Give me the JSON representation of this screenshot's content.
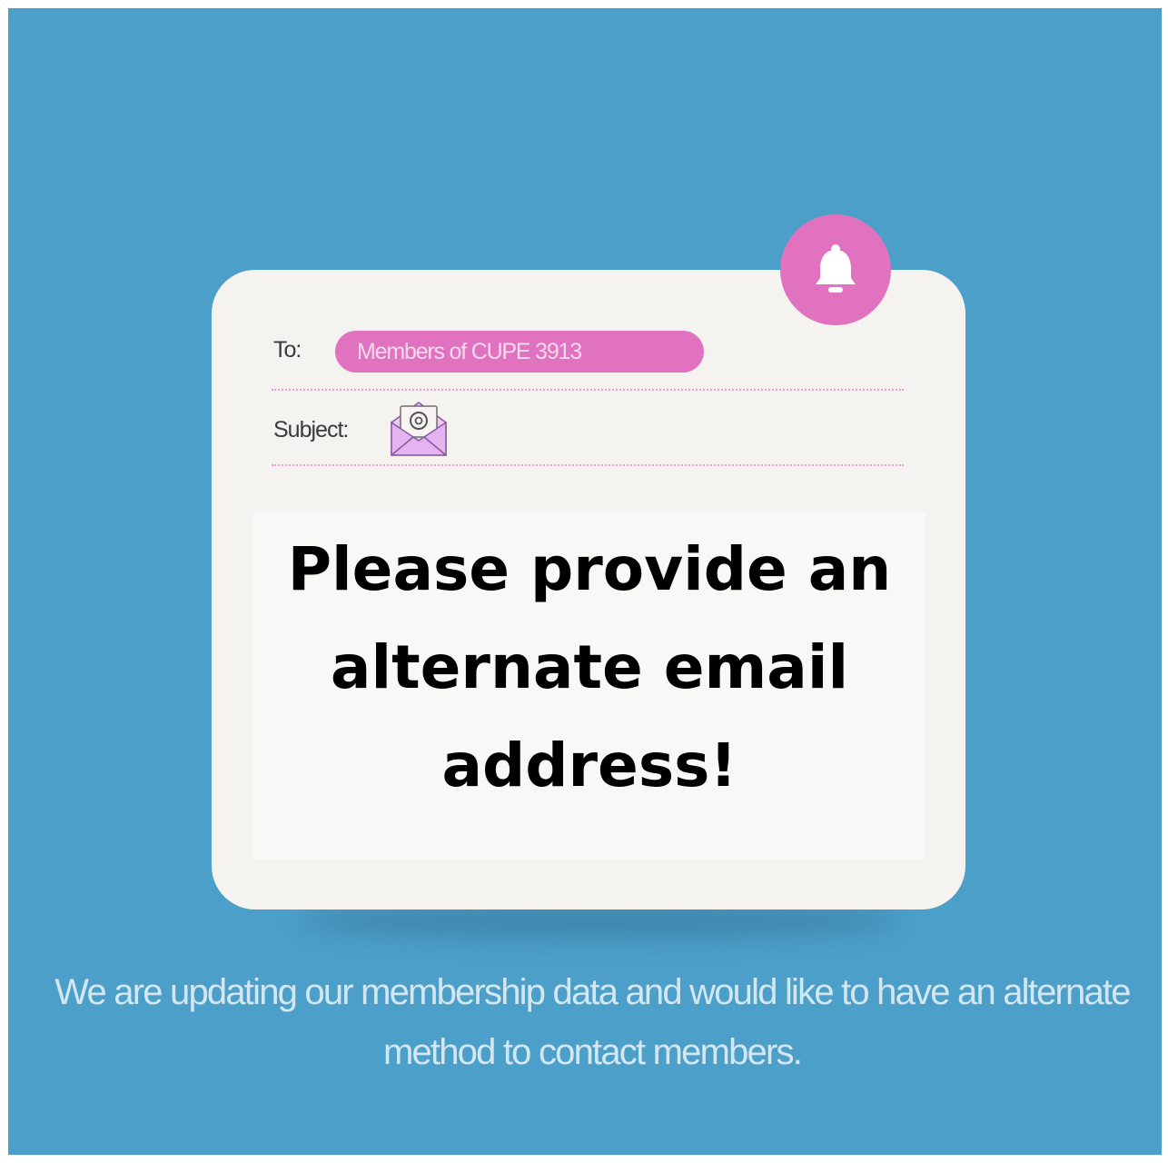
{
  "email_card": {
    "to_label": "To:",
    "recipient": "Members of CUPE 3913",
    "subject_label": "Subject:",
    "headline": "Please provide an alternate email address!"
  },
  "icons": {
    "notification": "bell-icon",
    "subject": "envelope-at-icon"
  },
  "footer": {
    "text": "We are updating our membership data and would like to have an alternate method to contact members."
  },
  "colors": {
    "background": "#4b9fc9",
    "accent_pink": "#e072bf",
    "card": "#f4f3f0",
    "headline": "#000000"
  }
}
